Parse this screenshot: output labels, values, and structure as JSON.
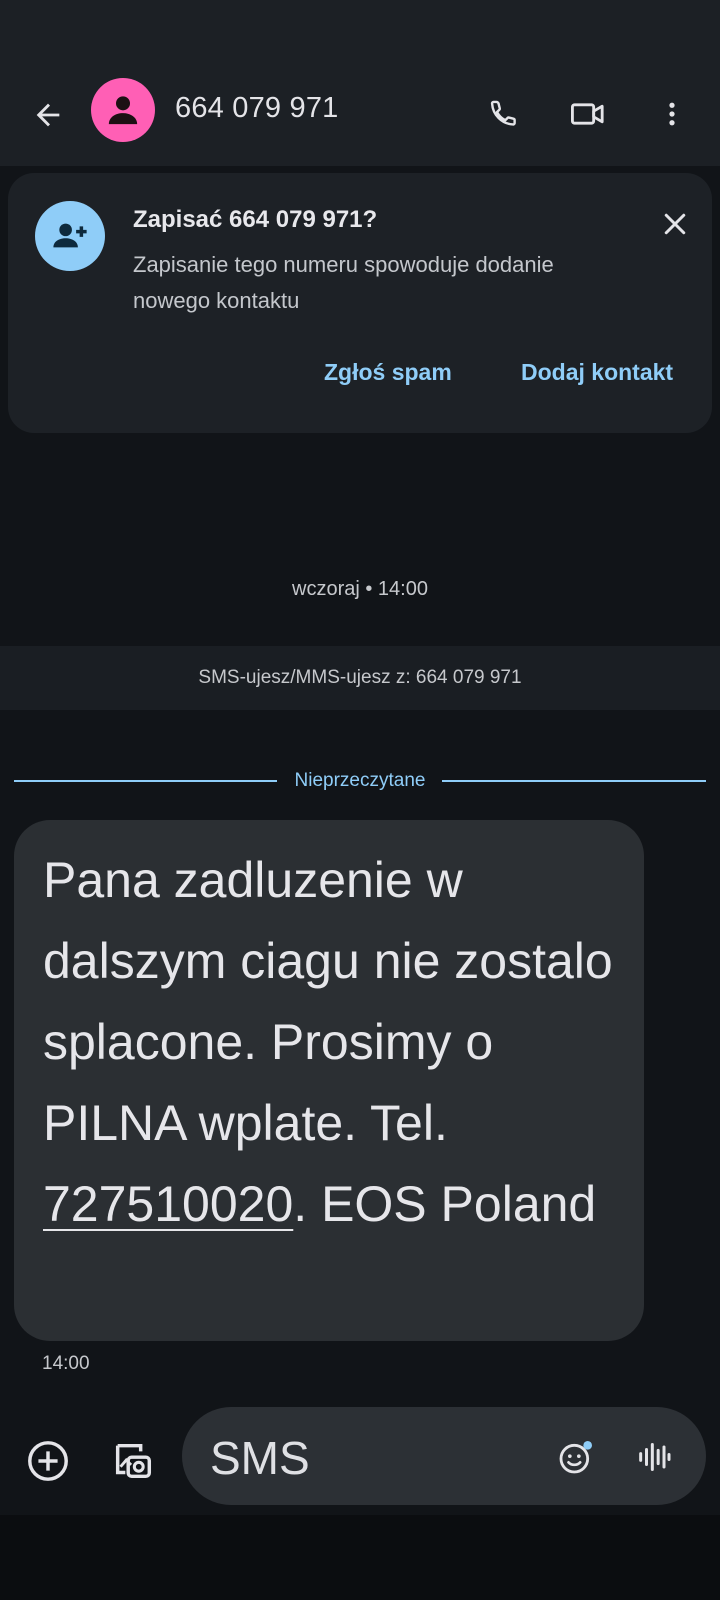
{
  "header": {
    "title": "664 079 971",
    "back_icon": "arrow-back-icon",
    "avatar_icon": "person-icon",
    "avatar_color": "#ff5fb5",
    "actions": [
      "phone-icon",
      "video-call-icon",
      "more-vert-icon"
    ]
  },
  "save_card": {
    "title": "Zapisać 664 079 971?",
    "description": "Zapisanie tego numeru spowoduje dodanie nowego kontaktu",
    "report_spam_label": "Zgłoś spam",
    "add_contact_label": "Dodaj kontakt",
    "icon": "person-add-icon",
    "accent_color": "#8fcdf8"
  },
  "conversation": {
    "date_header": "wczoraj • 14:00",
    "info_banner": "SMS-ujesz/MMS-ujesz z: 664 079 971",
    "unread_divider": "Nieprzeczytane",
    "messages": [
      {
        "text_before": "Pana zadluzenie w dalszym ciagu nie zostalo splacone. Prosimy o PILNA wplate. Tel. ",
        "phone_link": "727510020",
        "text_after": ". EOS Poland",
        "time": "14:00"
      }
    ]
  },
  "composer": {
    "placeholder": "SMS",
    "left_icons": [
      "add-circle-icon",
      "gallery-icon"
    ],
    "right_icons": [
      "emoji-icon",
      "voice-icon"
    ]
  }
}
